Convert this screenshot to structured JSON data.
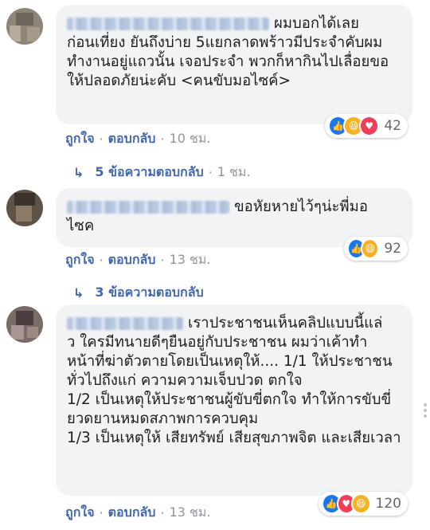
{
  "comments": [
    {
      "text_first": "ผมบอกได้เลย",
      "text_rest": "ก่อนเที่ยง ยันถึงบ่าย 5แยกลาดพร้าวมีประจำคับผมทำงานอยู่แถวนั้น เจอประจำ พวกก็หากินไปเลื่อยขอให้ปลอดภัยน่ะคับ <คนขับมอไซค์>",
      "reaction_count": "42",
      "like_label": "ถูกใจ",
      "reply_label": "ตอบกลับ",
      "time": "10 ชม.",
      "replies_label": "5 ข้อความตอบกลับ",
      "replies_time": "1 ชม."
    },
    {
      "text_first": "ขอหัยหายไว้ๆน่ะพี่มอ",
      "text_rest": "ไซค",
      "reaction_count": "92",
      "like_label": "ถูกใจ",
      "reply_label": "ตอบกลับ",
      "time": "13 ชม.",
      "replies_label": "3 ข้อความตอบกลับ"
    },
    {
      "text_first": "เราประชาชนเห็นคลิปแบบนี้แล่",
      "text_rest": "ว ใครมีทนายดีๆยืนอยู่กับประชาชน ผมว่าเค้าทำหน้าที่ฆ่าตัวตายโดยเป็นเหตุให้.... 1/1 ให้ประชาชนทั่วไปถึงแก่ ความความเจ็บปวด ตกใจ\n1/2 เป็นเหตุให้ประชาชนผู้ขับขี่ตกใจ ทำให้การขับขี่ยวดยานหมดสภาพการควบคุม\n1/3 เป็นเหตุให้ เสียทรัพย์ เสียสุขภาพจิต และเสียเวลา",
      "reaction_count": "120",
      "like_label": "ถูกใจ",
      "reply_label": "ตอบกลับ",
      "time": "13 ชม."
    }
  ],
  "colors": {
    "bubble": "#f2f3f5",
    "link": "#4267b2",
    "muted": "#90949c",
    "like": "#1877f2",
    "haha": "#f7b125",
    "love": "#f33e58"
  },
  "icons": [
    "like-reaction-icon",
    "haha-reaction-icon",
    "love-reaction-icon",
    "reply-arrow-icon"
  ],
  "glyphs": {
    "like": "👍",
    "haha": "😆",
    "love": "♥",
    "arrow": "↳",
    "dot": "·"
  }
}
